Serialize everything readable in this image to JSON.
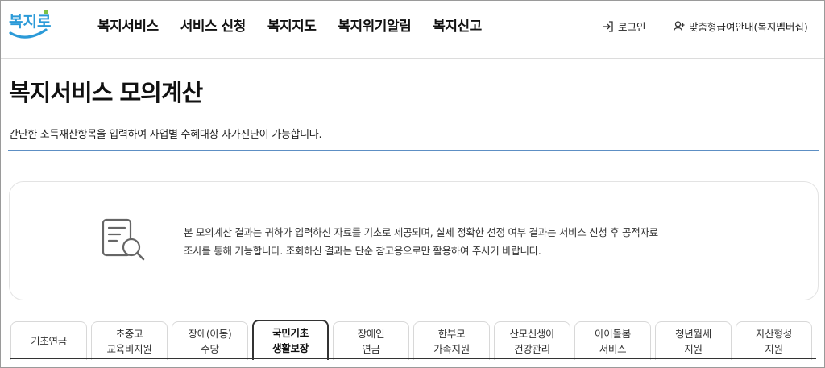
{
  "header": {
    "logo_text": "복지로",
    "nav": [
      {
        "label": "복지서비스"
      },
      {
        "label": "서비스 신청"
      },
      {
        "label": "복지지도"
      },
      {
        "label": "복지위기알림"
      },
      {
        "label": "복지신고"
      }
    ],
    "login_label": "로그인",
    "guide_label": "맞춤형급여안내(복지멤버십)"
  },
  "page": {
    "title": "복지서비스 모의계산",
    "description": "간단한 소득재산항목을 입력하여 사업별 수혜대상 자가진단이 가능합니다."
  },
  "notice": {
    "line1": "본 모의계산 결과는 귀하가 입력하신 자료를 기초로 제공되며, 실제 정확한 선정 여부 결과는 서비스 신청 후 공적자료",
    "line2": "조사를 통해 가능합니다. 조회하신 결과는 단순 참고용으로만 활용하여 주시기 바랍니다."
  },
  "tabs": [
    {
      "label": "기초연금",
      "active": false
    },
    {
      "label": "초중고\n교육비지원",
      "active": false
    },
    {
      "label": "장애(아동)\n수당",
      "active": false
    },
    {
      "label": "국민기초\n생활보장",
      "active": true
    },
    {
      "label": "장애인\n연금",
      "active": false
    },
    {
      "label": "한부모\n가족지원",
      "active": false
    },
    {
      "label": "산모신생아\n건강관리",
      "active": false
    },
    {
      "label": "아이돌봄\n서비스",
      "active": false
    },
    {
      "label": "청년월세\n지원",
      "active": false
    },
    {
      "label": "자산형성\n지원",
      "active": false
    }
  ],
  "colors": {
    "logo_blue": "#2b9ad8",
    "logo_green": "#7cc242",
    "rule_blue": "#5d8fc4",
    "active_tab_border": "#333333"
  }
}
